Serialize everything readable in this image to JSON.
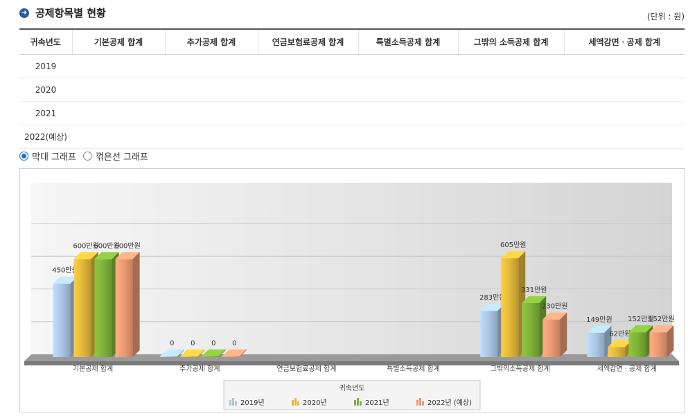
{
  "header": {
    "title": "공제항목별 현황",
    "unit": "(단위 : 원)"
  },
  "table": {
    "columns": [
      "귀속년도",
      "기본공제 합계",
      "추가공제 합계",
      "연금보험료공제 합계",
      "특별소득공제 합계",
      "그밖의 소득공제 합계",
      "세액감면ㆍ공제 합계"
    ],
    "rows": [
      "2019",
      "2020",
      "2021",
      "2022(예상)"
    ]
  },
  "view_options": {
    "bar": "막대 그래프",
    "line": "꺾은선 그래프",
    "selected": "bar"
  },
  "colors": {
    "2019": "#a9c6e3",
    "2020": "#e2b83a",
    "2021": "#7fb23a",
    "2022": "#ec9a73"
  },
  "chart_data": {
    "type": "bar",
    "categories": [
      "기본공제 합계",
      "추가공제 합계",
      "연금보험료공제 합계",
      "특별소득공제 합계",
      "그밖의소득공제 합계",
      "세액감면ㆍ공제 합계"
    ],
    "series": [
      {
        "name": "2019년",
        "values": [
          450,
          0,
          null,
          null,
          283,
          149
        ],
        "labels": [
          "450만원",
          "0",
          "",
          "",
          "283만원",
          "149만원"
        ]
      },
      {
        "name": "2020년",
        "values": [
          600,
          0,
          null,
          null,
          605,
          62
        ],
        "labels": [
          "600만원",
          "0",
          "",
          "",
          "605만원",
          "62만원"
        ]
      },
      {
        "name": "2021년",
        "values": [
          600,
          0,
          null,
          null,
          331,
          152
        ],
        "labels": [
          "600만원",
          "0",
          "",
          "",
          "331만원",
          "152만원"
        ]
      },
      {
        "name": "2022년 (예상)",
        "values": [
          600,
          0,
          null,
          null,
          230,
          152
        ],
        "labels": [
          "600만원",
          "0",
          "",
          "",
          "230만원",
          "152만원"
        ]
      }
    ],
    "legend_title": "귀속년도",
    "legend_position": "bottom-center",
    "grid": true
  }
}
